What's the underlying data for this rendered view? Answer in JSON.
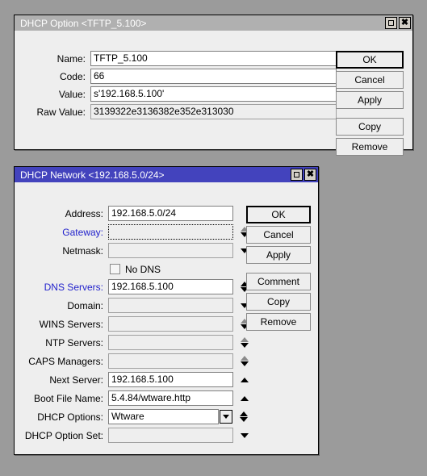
{
  "desktop": {
    "background": "#9b9b9b"
  },
  "option_dialog": {
    "title": "DHCP Option <TFTP_5.100>",
    "titlebar_state": "inactive",
    "titlebar_color": "#b0b0b0",
    "window_buttons": [
      {
        "name": "maximize",
        "glyph": "square"
      },
      {
        "name": "close",
        "glyph": "x"
      }
    ],
    "fields": [
      {
        "label": "Name:",
        "value": "TFTP_5.100",
        "state": "editable"
      },
      {
        "label": "Code:",
        "value": "66",
        "state": "editable"
      },
      {
        "label": "Value:",
        "value": "s'192.168.5.100'",
        "state": "editable"
      },
      {
        "label": "Raw Value:",
        "value": "3139322e3136382e352e313030",
        "state": "readonly"
      }
    ],
    "buttons": [
      {
        "label": "OK",
        "default": true
      },
      {
        "label": "Cancel",
        "default": false
      },
      {
        "label": "Apply",
        "default": false
      },
      {
        "label": "Copy",
        "default": false
      },
      {
        "label": "Remove",
        "default": false
      }
    ]
  },
  "network_dialog": {
    "title": "DHCP Network <192.168.5.0/24>",
    "titlebar_state": "active",
    "titlebar_color": "#4343bd",
    "window_buttons": [
      {
        "name": "maximize",
        "glyph": "square"
      },
      {
        "name": "close",
        "glyph": "x"
      }
    ],
    "checkbox": {
      "label": "No DNS",
      "checked": false
    },
    "fields": [
      {
        "label": "Address:",
        "value": "192.168.5.0/24",
        "state": "editable",
        "link": false,
        "widget": "none"
      },
      {
        "label": "Gateway:",
        "value": "",
        "state": "focus",
        "link": true,
        "widget": "spinner-dim-up"
      },
      {
        "label": "Netmask:",
        "value": "",
        "state": "empty",
        "link": false,
        "widget": "down"
      },
      {
        "label": "DNS Servers:",
        "value": "192.168.5.100",
        "state": "editable",
        "link": true,
        "widget": "spinner"
      },
      {
        "label": "Domain:",
        "value": "",
        "state": "empty",
        "link": false,
        "widget": "down"
      },
      {
        "label": "WINS Servers:",
        "value": "",
        "state": "empty",
        "link": false,
        "widget": "spinner-dim-up"
      },
      {
        "label": "NTP Servers:",
        "value": "",
        "state": "empty",
        "link": false,
        "widget": "spinner-dim-up"
      },
      {
        "label": "CAPS Managers:",
        "value": "",
        "state": "empty",
        "link": false,
        "widget": "spinner-dim-up"
      },
      {
        "label": "Next Server:",
        "value": "192.168.5.100",
        "state": "editable",
        "link": false,
        "widget": "up"
      },
      {
        "label": "Boot File Name:",
        "value": "5.4.84/wtware.http",
        "state": "editable",
        "link": false,
        "widget": "up"
      },
      {
        "label": "DHCP Options:",
        "value": "Wtware",
        "state": "editable",
        "link": false,
        "widget": "combo-spinner"
      },
      {
        "label": "DHCP Option Set:",
        "value": "",
        "state": "empty",
        "link": false,
        "widget": "down"
      }
    ],
    "buttons": [
      {
        "label": "OK",
        "default": true
      },
      {
        "label": "Cancel",
        "default": false
      },
      {
        "label": "Apply",
        "default": false
      },
      {
        "label": "Comment",
        "default": false
      },
      {
        "label": "Copy",
        "default": false
      },
      {
        "label": "Remove",
        "default": false
      }
    ]
  }
}
